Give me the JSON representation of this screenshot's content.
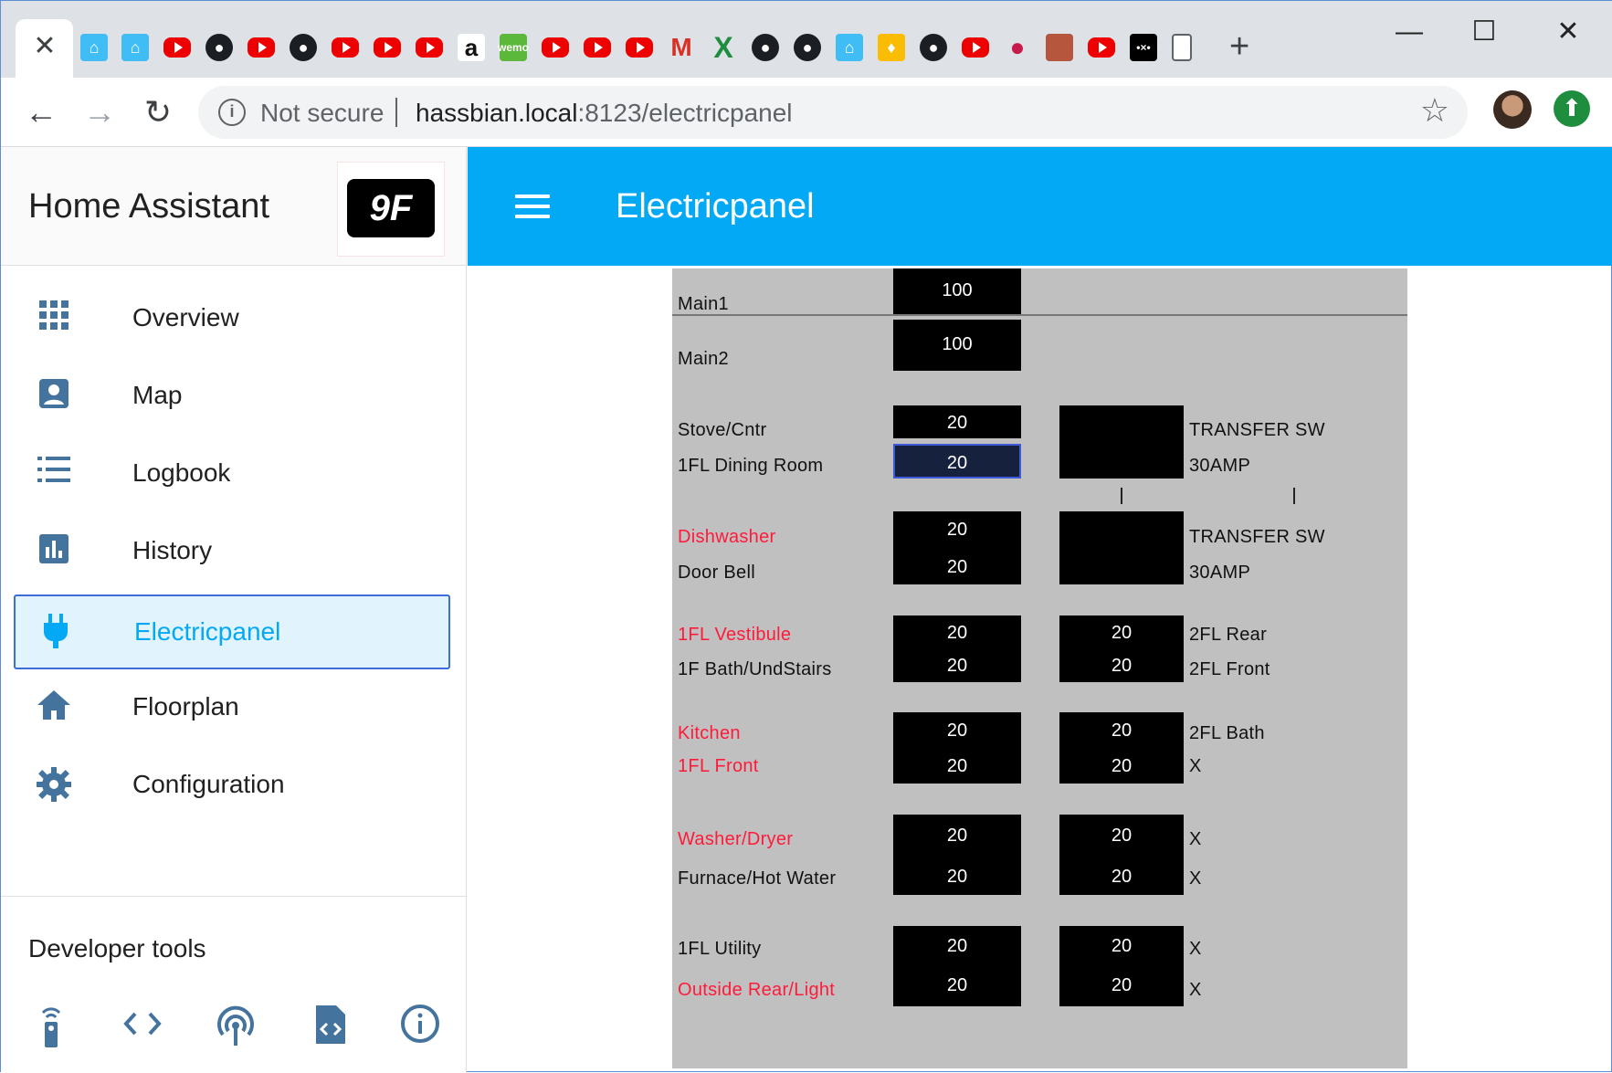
{
  "browser": {
    "close_tab": "✕",
    "new_tab": "+",
    "window_controls": {
      "minimize": "—",
      "maximize": "☐",
      "close": "✕"
    },
    "not_secure": "Not secure",
    "url_host": "hassbian.local",
    "url_rest": ":8123/electricpanel",
    "back": "←",
    "forward": "→",
    "reload": "↻",
    "bookmark": "☆",
    "update": "⬆"
  },
  "tabs": [
    {
      "icon": "home-assistant-icon"
    },
    {
      "icon": "home-assistant-icon"
    },
    {
      "icon": "youtube-icon"
    },
    {
      "icon": "github-icon"
    },
    {
      "icon": "youtube-icon"
    },
    {
      "icon": "github-icon"
    },
    {
      "icon": "youtube-icon"
    },
    {
      "icon": "youtube-icon"
    },
    {
      "icon": "youtube-icon"
    },
    {
      "icon": "amazon-icon"
    },
    {
      "icon": "wemo-icon"
    },
    {
      "icon": "youtube-icon"
    },
    {
      "icon": "youtube-icon"
    },
    {
      "icon": "youtube-icon"
    },
    {
      "icon": "gmail-icon"
    },
    {
      "icon": "excel-icon"
    },
    {
      "icon": "github-icon"
    },
    {
      "icon": "github-icon"
    },
    {
      "icon": "home-assistant-icon"
    },
    {
      "icon": "bulb-icon"
    },
    {
      "icon": "github-icon"
    },
    {
      "icon": "youtube-icon"
    },
    {
      "icon": "raspberry-pi-icon"
    },
    {
      "icon": "profile-icon"
    },
    {
      "icon": "youtube-icon"
    },
    {
      "icon": "medium-icon"
    },
    {
      "icon": "document-icon"
    }
  ],
  "sidebar": {
    "title": "Home Assistant",
    "logo_text": "9F",
    "items": [
      {
        "label": "Overview",
        "icon": "grid-icon"
      },
      {
        "label": "Map",
        "icon": "account-box-icon"
      },
      {
        "label": "Logbook",
        "icon": "list-icon"
      },
      {
        "label": "History",
        "icon": "chart-icon"
      },
      {
        "label": "Electricpanel",
        "icon": "plug-icon"
      },
      {
        "label": "Floorplan",
        "icon": "home-icon"
      },
      {
        "label": "Configuration",
        "icon": "gear-icon"
      }
    ],
    "developer_tools": "Developer tools",
    "dev_icons": [
      "remote-icon",
      "code-icon",
      "broadcast-icon",
      "file-code-icon",
      "info-icon"
    ]
  },
  "header": {
    "title": "Electricpanel"
  },
  "panel": {
    "main1": {
      "label": "Main1",
      "value": "100"
    },
    "main2": {
      "label": "Main2",
      "value": "100"
    },
    "rows": [
      {
        "left_top": "Stove/Cntr",
        "left_bottom": "1FL Dining Room",
        "v1": "20",
        "v2": "20",
        "r1": "",
        "r2": "",
        "right_top": "TRANSFER SW",
        "right_bottom": "30AMP"
      },
      {
        "left_top": "Dishwasher",
        "left_bottom": "Door Bell",
        "v1": "20",
        "v2": "20",
        "r1": "",
        "r2": "",
        "right_top": "TRANSFER SW",
        "right_bottom": "30AMP"
      },
      {
        "left_top": "1FL Vestibule",
        "left_bottom": "1F Bath/UndStairs",
        "v1": "20",
        "v2": "20",
        "r1": "20",
        "r2": "20",
        "right_top": "2FL Rear",
        "right_bottom": "2FL Front"
      },
      {
        "left_top": "Kitchen",
        "left_bottom": "1FL Front",
        "v1": "20",
        "v2": "20",
        "r1": "20",
        "r2": "20",
        "right_top": "2FL Bath",
        "right_bottom": "X"
      },
      {
        "left_top": "Washer/Dryer",
        "left_bottom": "Furnace/Hot Water",
        "v1": "20",
        "v2": "20",
        "r1": "20",
        "r2": "20",
        "right_top": "X",
        "right_bottom": "X"
      },
      {
        "left_top": "1FL Utility",
        "left_bottom": "Outside Rear/Light",
        "v1": "20",
        "v2": "20",
        "r1": "20",
        "r2": "20",
        "right_top": "X",
        "right_bottom": "X"
      }
    ],
    "tick": "|",
    "colors": {
      "red_label": "#ff1a3a",
      "panel_bg": "#c0c0c0",
      "accent": "#03a9f4"
    }
  }
}
